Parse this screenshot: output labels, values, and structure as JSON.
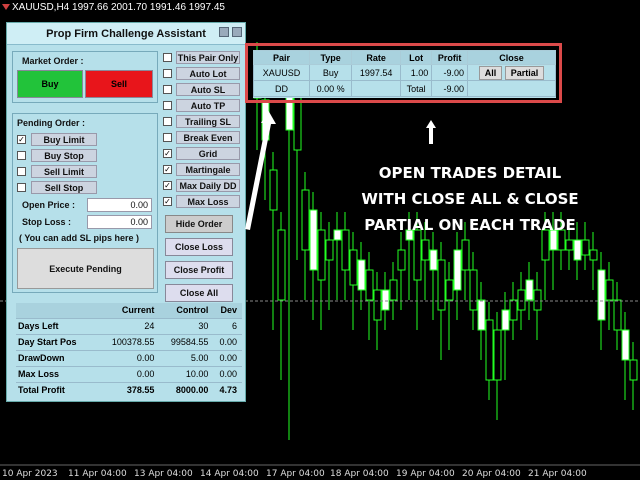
{
  "symbol": {
    "title": "XAUUSD,H4  1997.66 2001.70 1991.46 1997.45"
  },
  "panel": {
    "title": "Prop Firm Challenge Assistant",
    "market_order_label": "Market Order :",
    "buy_label": "Buy",
    "sell_label": "Sell",
    "pending_order_label": "Pending Order :",
    "pending_items": [
      {
        "label": "Buy Limit",
        "checked": true
      },
      {
        "label": "Buy Stop",
        "checked": false
      },
      {
        "label": "Sell Limit",
        "checked": false
      },
      {
        "label": "Sell Stop",
        "checked": false
      }
    ],
    "open_price_label": "Open Price :",
    "open_price_value": "0.00",
    "stop_loss_label": "Stop Loss :",
    "stop_loss_value": "0.00",
    "sl_note": "( You can add SL pips here )",
    "execute_pending_label": "Execute Pending",
    "options": [
      {
        "label": "This Pair Only",
        "checked": false
      },
      {
        "label": "Auto Lot",
        "checked": false
      },
      {
        "label": "Auto SL",
        "checked": false
      },
      {
        "label": "Auto TP",
        "checked": false
      },
      {
        "label": "Trailing SL",
        "checked": false
      },
      {
        "label": "Break Even",
        "checked": false
      },
      {
        "label": "Grid",
        "checked": true
      },
      {
        "label": "Martingale",
        "checked": true
      },
      {
        "label": "Max Daily DD",
        "checked": true
      },
      {
        "label": "Max Loss",
        "checked": true
      }
    ],
    "hide_order_label": "Hide Order",
    "close_loss_label": "Close Loss",
    "close_profit_label": "Close Profit",
    "close_all_label": "Close All",
    "stats": {
      "headers": [
        "",
        "Current",
        "Control",
        "Dev"
      ],
      "rows": [
        [
          "Days Left",
          "24",
          "30",
          "6"
        ],
        [
          "Day Start Pos",
          "100378.55",
          "99584.55",
          "0.00"
        ],
        [
          "DrawDown",
          "0.00",
          "5.00",
          "0.00"
        ],
        [
          "Max Loss",
          "0.00",
          "10.00",
          "0.00"
        ],
        [
          "Total Profit",
          "378.55",
          "8000.00",
          "4.73"
        ]
      ]
    }
  },
  "trades": {
    "headers": [
      "Pair",
      "Type",
      "Rate",
      "Lot",
      "Profit",
      "Close"
    ],
    "row": {
      "pair": "XAUUSD",
      "type": "Buy",
      "rate": "1997.54",
      "lot": "1.00",
      "profit": "-9.00",
      "close_all": "All",
      "close_partial": "Partial"
    },
    "dd_row": {
      "dd_label": "DD",
      "dd_value": "0.00 %",
      "total_label": "Total",
      "total_value": "-9.00"
    }
  },
  "callout": {
    "line1": "OPEN TRADES DETAIL",
    "line2": "WITH CLOSE ALL & CLOSE",
    "line3": "PARTIAL ON EACH TRADE"
  },
  "x_axis": [
    "10 Apr 2023",
    "11 Apr 04:00",
    "13 Apr 04:00",
    "14 Apr 04:00",
    "17 Apr 04:00",
    "18 Apr 04:00",
    "19 Apr 04:00",
    "20 Apr 04:00",
    "21 Apr 04:00"
  ],
  "colors": {
    "bull": "#22ff22",
    "bear": "#ffffff",
    "buy": "#22c33a",
    "sell": "#e8151b",
    "highlight": "#dc4a4a"
  }
}
